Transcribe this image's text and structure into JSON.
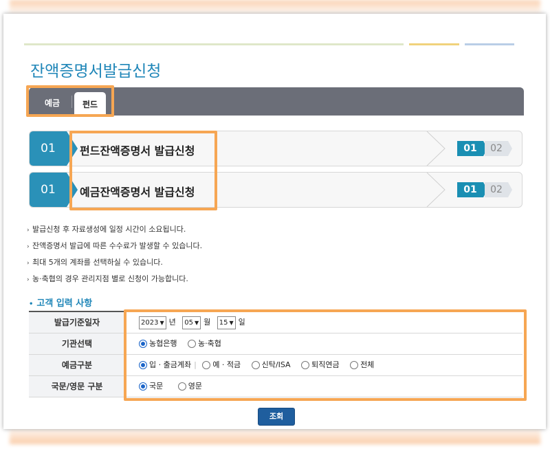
{
  "page_title": "잔액증명서발급신청",
  "tabs": [
    {
      "label": "예금",
      "active": false
    },
    {
      "label": "펀드",
      "active": true
    }
  ],
  "steps": [
    {
      "number": "01",
      "title": "펀드잔액증명서 발급신청",
      "badges": [
        "01",
        "02"
      ]
    },
    {
      "number": "01",
      "title": "예금잔액증명서 발급신청",
      "badges": [
        "01",
        "02"
      ]
    }
  ],
  "notes": [
    "발급신청 후 자료생성에 일정 시간이 소요됩니다.",
    "잔액증명서 발급에 따른 수수료가 발생할 수 있습니다.",
    "최대 5개의 계좌를 선택하실 수 있습니다.",
    "농·축협의 경우 관리지점 별로 신청이 가능합니다."
  ],
  "form": {
    "section_title": "고객 입력 사항",
    "issue_date": {
      "label": "발급기준일자",
      "year": "2023",
      "year_unit": "년",
      "month": "05",
      "month_unit": "월",
      "day": "15",
      "day_unit": "일"
    },
    "institution": {
      "label": "기관선택",
      "options": [
        "농협은행",
        "농·축협"
      ],
      "selected": "농협은행"
    },
    "deposit_type": {
      "label": "예금구분",
      "options": [
        "입 · 출금계좌",
        "예 · 적금",
        "신탁/ISA",
        "퇴직연금",
        "전체"
      ],
      "selected": "입 · 출금계좌"
    },
    "language": {
      "label": "국문/영문 구분",
      "options": [
        "국문",
        "영문"
      ],
      "selected": "국문"
    }
  },
  "search_button": "조회",
  "colors": {
    "accent": "#1f86b8",
    "highlight": "#f6a653",
    "tab_bar": "#6b6e78",
    "button": "#1f5e9e"
  }
}
